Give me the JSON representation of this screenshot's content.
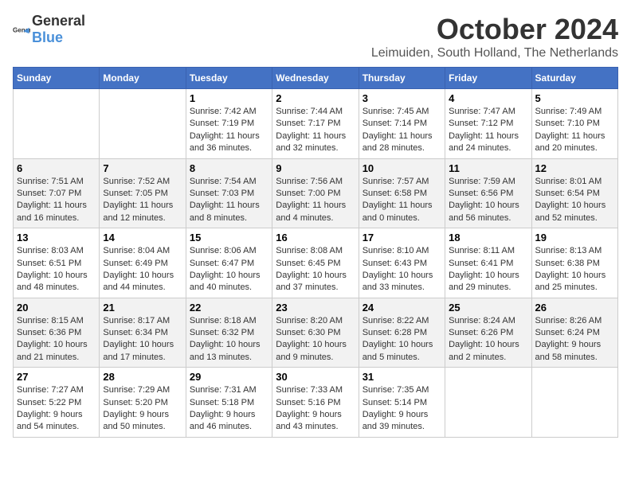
{
  "header": {
    "logo_general": "General",
    "logo_blue": "Blue",
    "month_title": "October 2024",
    "location": "Leimuiden, South Holland, The Netherlands"
  },
  "days_of_week": [
    "Sunday",
    "Monday",
    "Tuesday",
    "Wednesday",
    "Thursday",
    "Friday",
    "Saturday"
  ],
  "weeks": [
    [
      {
        "day": "",
        "info": ""
      },
      {
        "day": "",
        "info": ""
      },
      {
        "day": "1",
        "info": "Sunrise: 7:42 AM\nSunset: 7:19 PM\nDaylight: 11 hours and 36 minutes."
      },
      {
        "day": "2",
        "info": "Sunrise: 7:44 AM\nSunset: 7:17 PM\nDaylight: 11 hours and 32 minutes."
      },
      {
        "day": "3",
        "info": "Sunrise: 7:45 AM\nSunset: 7:14 PM\nDaylight: 11 hours and 28 minutes."
      },
      {
        "day": "4",
        "info": "Sunrise: 7:47 AM\nSunset: 7:12 PM\nDaylight: 11 hours and 24 minutes."
      },
      {
        "day": "5",
        "info": "Sunrise: 7:49 AM\nSunset: 7:10 PM\nDaylight: 11 hours and 20 minutes."
      }
    ],
    [
      {
        "day": "6",
        "info": "Sunrise: 7:51 AM\nSunset: 7:07 PM\nDaylight: 11 hours and 16 minutes."
      },
      {
        "day": "7",
        "info": "Sunrise: 7:52 AM\nSunset: 7:05 PM\nDaylight: 11 hours and 12 minutes."
      },
      {
        "day": "8",
        "info": "Sunrise: 7:54 AM\nSunset: 7:03 PM\nDaylight: 11 hours and 8 minutes."
      },
      {
        "day": "9",
        "info": "Sunrise: 7:56 AM\nSunset: 7:00 PM\nDaylight: 11 hours and 4 minutes."
      },
      {
        "day": "10",
        "info": "Sunrise: 7:57 AM\nSunset: 6:58 PM\nDaylight: 11 hours and 0 minutes."
      },
      {
        "day": "11",
        "info": "Sunrise: 7:59 AM\nSunset: 6:56 PM\nDaylight: 10 hours and 56 minutes."
      },
      {
        "day": "12",
        "info": "Sunrise: 8:01 AM\nSunset: 6:54 PM\nDaylight: 10 hours and 52 minutes."
      }
    ],
    [
      {
        "day": "13",
        "info": "Sunrise: 8:03 AM\nSunset: 6:51 PM\nDaylight: 10 hours and 48 minutes."
      },
      {
        "day": "14",
        "info": "Sunrise: 8:04 AM\nSunset: 6:49 PM\nDaylight: 10 hours and 44 minutes."
      },
      {
        "day": "15",
        "info": "Sunrise: 8:06 AM\nSunset: 6:47 PM\nDaylight: 10 hours and 40 minutes."
      },
      {
        "day": "16",
        "info": "Sunrise: 8:08 AM\nSunset: 6:45 PM\nDaylight: 10 hours and 37 minutes."
      },
      {
        "day": "17",
        "info": "Sunrise: 8:10 AM\nSunset: 6:43 PM\nDaylight: 10 hours and 33 minutes."
      },
      {
        "day": "18",
        "info": "Sunrise: 8:11 AM\nSunset: 6:41 PM\nDaylight: 10 hours and 29 minutes."
      },
      {
        "day": "19",
        "info": "Sunrise: 8:13 AM\nSunset: 6:38 PM\nDaylight: 10 hours and 25 minutes."
      }
    ],
    [
      {
        "day": "20",
        "info": "Sunrise: 8:15 AM\nSunset: 6:36 PM\nDaylight: 10 hours and 21 minutes."
      },
      {
        "day": "21",
        "info": "Sunrise: 8:17 AM\nSunset: 6:34 PM\nDaylight: 10 hours and 17 minutes."
      },
      {
        "day": "22",
        "info": "Sunrise: 8:18 AM\nSunset: 6:32 PM\nDaylight: 10 hours and 13 minutes."
      },
      {
        "day": "23",
        "info": "Sunrise: 8:20 AM\nSunset: 6:30 PM\nDaylight: 10 hours and 9 minutes."
      },
      {
        "day": "24",
        "info": "Sunrise: 8:22 AM\nSunset: 6:28 PM\nDaylight: 10 hours and 5 minutes."
      },
      {
        "day": "25",
        "info": "Sunrise: 8:24 AM\nSunset: 6:26 PM\nDaylight: 10 hours and 2 minutes."
      },
      {
        "day": "26",
        "info": "Sunrise: 8:26 AM\nSunset: 6:24 PM\nDaylight: 9 hours and 58 minutes."
      }
    ],
    [
      {
        "day": "27",
        "info": "Sunrise: 7:27 AM\nSunset: 5:22 PM\nDaylight: 9 hours and 54 minutes."
      },
      {
        "day": "28",
        "info": "Sunrise: 7:29 AM\nSunset: 5:20 PM\nDaylight: 9 hours and 50 minutes."
      },
      {
        "day": "29",
        "info": "Sunrise: 7:31 AM\nSunset: 5:18 PM\nDaylight: 9 hours and 46 minutes."
      },
      {
        "day": "30",
        "info": "Sunrise: 7:33 AM\nSunset: 5:16 PM\nDaylight: 9 hours and 43 minutes."
      },
      {
        "day": "31",
        "info": "Sunrise: 7:35 AM\nSunset: 5:14 PM\nDaylight: 9 hours and 39 minutes."
      },
      {
        "day": "",
        "info": ""
      },
      {
        "day": "",
        "info": ""
      }
    ]
  ]
}
